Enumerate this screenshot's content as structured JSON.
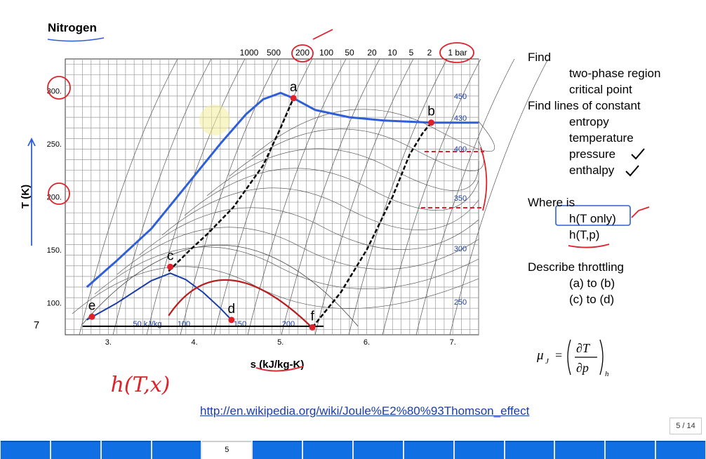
{
  "slide": {
    "title": "Nitrogen"
  },
  "chart_data": {
    "type": "line",
    "title": "",
    "xlabel": "s (kJ/kg-K)",
    "ylabel": "T (K)",
    "xlim": [
      2.5,
      7.3
    ],
    "ylim": [
      70,
      330
    ],
    "x_ticks": [
      "3.",
      "4.",
      "5.",
      "6.",
      "7."
    ],
    "y_ticks": [
      "300.",
      "250.",
      "200.",
      "150.",
      "100."
    ],
    "y_tick_values": [
      300,
      250,
      200,
      150,
      100
    ],
    "extra_y_label": "7",
    "grid": true,
    "pressure_labels_top": [
      "1000",
      "500",
      "200",
      "100",
      "50",
      "20",
      "10",
      "5",
      "2",
      "1 bar"
    ],
    "enthalpy_labels_right": [
      "450",
      "430",
      "400",
      "350",
      "300",
      "250"
    ],
    "enthalpy_labels_bottom": [
      "50 kJ/kg",
      "100",
      "150",
      "200"
    ],
    "points": [
      {
        "label": "a",
        "s": 5.15,
        "T": 293
      },
      {
        "label": "b",
        "s": 6.75,
        "T": 270
      },
      {
        "label": "c",
        "s": 3.72,
        "T": 134
      },
      {
        "label": "d",
        "s": 4.43,
        "T": 84
      },
      {
        "label": "e",
        "s": 2.81,
        "T": 87
      },
      {
        "label": "f",
        "s": 5.37,
        "T": 77
      }
    ],
    "series": [
      {
        "name": "",
        "s": [
          2.75,
          3.1,
          3.5,
          3.9,
          4.3,
          4.6,
          4.8,
          5.0,
          5.15,
          5.4,
          5.8,
          6.2,
          6.75,
          7.3
        ],
        "T": [
          115,
          140,
          170,
          210,
          250,
          278,
          292,
          298,
          293,
          282,
          275,
          272,
          270,
          270
        ]
      },
      {
        "name": "",
        "s": [
          2.75,
          3.1,
          3.5,
          3.72,
          3.9,
          4.1,
          4.3,
          4.43
        ],
        "T": [
          84,
          100,
          121,
          128,
          122,
          110,
          95,
          84
        ]
      },
      {
        "name": "",
        "s": [
          3.7,
          3.95,
          4.15,
          4.45,
          4.8,
          5.0,
          5.15
        ],
        "T": [
          130,
          150,
          165,
          190,
          230,
          265,
          293
        ]
      },
      {
        "name": "",
        "s": [
          5.37,
          5.7,
          6.0,
          6.3,
          6.5,
          6.65,
          6.75
        ],
        "T": [
          77,
          110,
          150,
          200,
          240,
          260,
          270
        ]
      }
    ]
  },
  "find": {
    "heading1": "Find",
    "items1": [
      "two-phase region",
      "critical point"
    ],
    "heading2": "Find lines of constant",
    "items2": [
      "entropy",
      "temperature",
      "pressure",
      "enthalpy"
    ],
    "heading3": "Where is",
    "items3": [
      "h(T only)",
      "h(T,p)"
    ],
    "heading4": "Describe throttling",
    "items4": [
      "(a) to (b)",
      "(c) to (d)"
    ]
  },
  "equation": {
    "lhs": "μ",
    "lhs_sub": "J",
    "num": "∂T",
    "den": "∂p",
    "sub": "h"
  },
  "handwritten": "h(T,x)",
  "link": "http://en.wikipedia.org/wiki/Joule%E2%80%93Thomson_effect",
  "page_indicator": "5 / 14",
  "strip": {
    "current_label": "5",
    "count": 14,
    "current_index": 4
  },
  "colors": {
    "annotation_red": "#e0202a",
    "annotation_blue": "#2f5fd8",
    "strip_blue": "#0f6fe3"
  }
}
